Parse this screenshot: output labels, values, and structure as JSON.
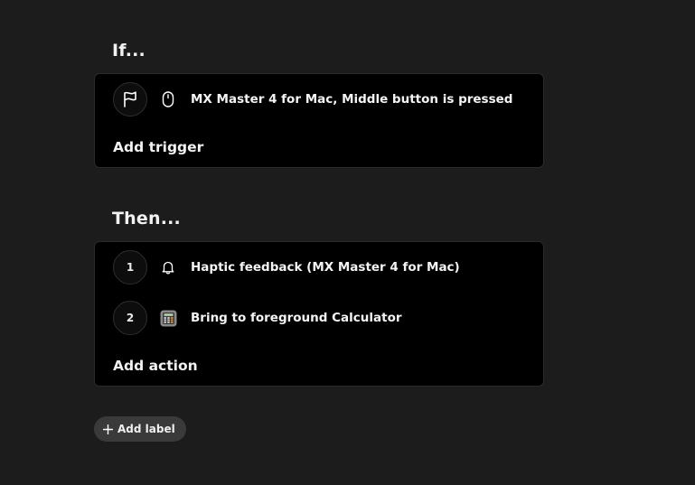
{
  "if_section": {
    "title": "If...",
    "trigger": {
      "icon": "flag-icon",
      "device_icon": "mouse-icon",
      "text": "MX Master 4 for Mac, Middle button is pressed"
    },
    "add_label": "Add trigger"
  },
  "then_section": {
    "title": "Then...",
    "actions": [
      {
        "number": "1",
        "icon": "bell-icon",
        "text": "Haptic feedback (MX Master 4 for Mac)"
      },
      {
        "number": "2",
        "icon": "calculator-icon",
        "text": "Bring to foreground Calculator"
      }
    ],
    "add_label": "Add action"
  },
  "label_button": {
    "icon": "plus-icon",
    "text": "Add label"
  }
}
